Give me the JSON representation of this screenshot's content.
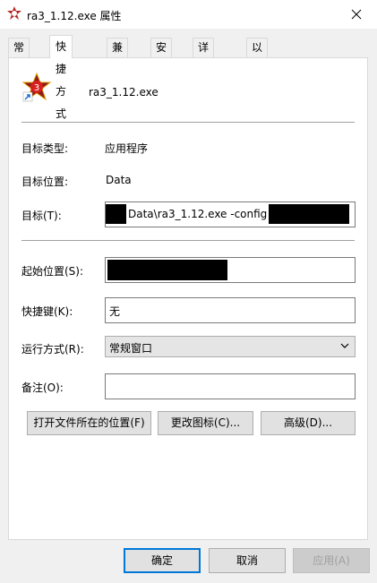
{
  "window": {
    "title": "ra3_1.12.exe 属性",
    "close_icon": "close-icon"
  },
  "tabs": [
    {
      "label": "常规"
    },
    {
      "label": "快捷方式"
    },
    {
      "label": "兼容性"
    },
    {
      "label": "安全"
    },
    {
      "label": "详细信息"
    },
    {
      "label": "以前的版本"
    }
  ],
  "active_tab": "快捷方式",
  "shortcut": {
    "name": "ra3_1.12.exe",
    "target_type_label": "目标类型:",
    "target_type_value": "应用程序",
    "target_location_label": "目标位置:",
    "target_location_value": "Data",
    "target_label": "目标(T):",
    "target_value": "Data\\ra3_1.12.exe -config \"",
    "start_in_label": "起始位置(S):",
    "start_in_value": "",
    "hotkey_label": "快捷键(K):",
    "hotkey_value": "无",
    "run_label": "运行方式(R):",
    "run_value": "常规窗口",
    "comment_label": "备注(O):",
    "comment_value": ""
  },
  "buttons": {
    "open_location": "打开文件所在的位置(F)",
    "change_icon": "更改图标(C)...",
    "advanced": "高级(D)..."
  },
  "footer": {
    "ok": "确定",
    "cancel": "取消",
    "apply": "应用(A)"
  },
  "colors": {
    "accent": "#0078d7",
    "window_bg": "#f0f0f0",
    "panel_bg": "#ffffff"
  }
}
